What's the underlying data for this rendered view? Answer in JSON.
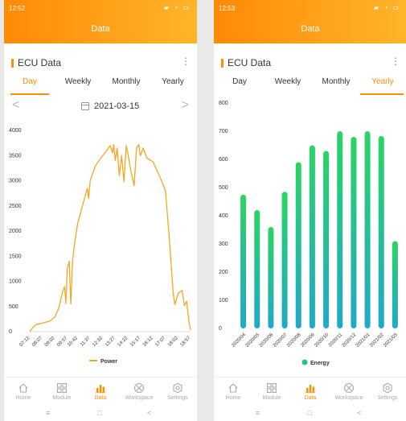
{
  "screens": [
    {
      "status": {
        "time": "12:52",
        "icons": "▰ ◔ ▭"
      },
      "header": {
        "title": "Data"
      },
      "card": {
        "title": "ECU Data",
        "more": "⋮"
      },
      "tabs": [
        {
          "label": "Day",
          "active": true
        },
        {
          "label": "Weekly",
          "active": false
        },
        {
          "label": "Monthly",
          "active": false
        },
        {
          "label": "Yearly",
          "active": false
        }
      ],
      "date": {
        "prev": "<",
        "value": "2021-03-15",
        "next": ">"
      },
      "nav": [
        {
          "label": "Home",
          "icon": "home-icon",
          "active": false
        },
        {
          "label": "Module",
          "icon": "grid-icon",
          "active": false
        },
        {
          "label": "Data",
          "icon": "bar-chart-icon",
          "active": true
        },
        {
          "label": "Workspace",
          "icon": "workspace-icon",
          "active": false
        },
        {
          "label": "Settings",
          "icon": "gear-icon",
          "active": false
        }
      ],
      "sysnav": {
        "menu": "≡",
        "home": "□",
        "back": "<"
      }
    },
    {
      "status": {
        "time": "12:53",
        "icons": "▰ ◔ ▭"
      },
      "header": {
        "title": "Data"
      },
      "card": {
        "title": "ECU Data",
        "more": "⋮"
      },
      "tabs": [
        {
          "label": "Day",
          "active": false
        },
        {
          "label": "Weekly",
          "active": false
        },
        {
          "label": "Monthly",
          "active": false
        },
        {
          "label": "Yearly",
          "active": true
        }
      ],
      "nav": [
        {
          "label": "Home",
          "icon": "home-icon",
          "active": false
        },
        {
          "label": "Module",
          "icon": "grid-icon",
          "active": false
        },
        {
          "label": "Data",
          "icon": "bar-chart-icon",
          "active": true
        },
        {
          "label": "Workspace",
          "icon": "workspace-icon",
          "active": false
        },
        {
          "label": "Settings",
          "icon": "gear-icon",
          "active": false
        }
      ],
      "sysnav": {
        "menu": "≡",
        "home": "□",
        "back": "<"
      }
    }
  ],
  "chart_data": [
    {
      "type": "line",
      "series": [
        {
          "name": "Power",
          "color": "#f5a623"
        }
      ],
      "x": [
        "07:12",
        "08:07",
        "09:02",
        "09:57",
        "10:42",
        "11:37",
        "12:32",
        "13:27",
        "14:22",
        "15:17",
        "16:12",
        "17:07",
        "18:02",
        "18:57"
      ],
      "points": [
        [
          "07:12",
          0
        ],
        [
          "07:25",
          80
        ],
        [
          "07:40",
          140
        ],
        [
          "08:07",
          170
        ],
        [
          "08:40",
          210
        ],
        [
          "09:02",
          290
        ],
        [
          "09:20",
          480
        ],
        [
          "09:35",
          780
        ],
        [
          "09:45",
          900
        ],
        [
          "09:50",
          560
        ],
        [
          "09:57",
          1250
        ],
        [
          "10:05",
          1400
        ],
        [
          "10:12",
          550
        ],
        [
          "10:20",
          1420
        ],
        [
          "10:30",
          1800
        ],
        [
          "10:42",
          2150
        ],
        [
          "11:00",
          2450
        ],
        [
          "11:15",
          2700
        ],
        [
          "11:25",
          2850
        ],
        [
          "11:30",
          2650
        ],
        [
          "11:37",
          3000
        ],
        [
          "12:00",
          3300
        ],
        [
          "12:32",
          3500
        ],
        [
          "12:50",
          3600
        ],
        [
          "13:05",
          3700
        ],
        [
          "13:15",
          3550
        ],
        [
          "13:20",
          3720
        ],
        [
          "13:27",
          3400
        ],
        [
          "13:35",
          3650
        ],
        [
          "13:45",
          3100
        ],
        [
          "13:55",
          3500
        ],
        [
          "14:05",
          2980
        ],
        [
          "14:15",
          3700
        ],
        [
          "14:22",
          3550
        ],
        [
          "14:35",
          3200
        ],
        [
          "14:50",
          2900
        ],
        [
          "15:00",
          3650
        ],
        [
          "15:10",
          3720
        ],
        [
          "15:17",
          3500
        ],
        [
          "15:30",
          3650
        ],
        [
          "15:45",
          3450
        ],
        [
          "16:12",
          3380
        ],
        [
          "16:30",
          3200
        ],
        [
          "16:50",
          3000
        ],
        [
          "17:07",
          2800
        ],
        [
          "17:25",
          1800
        ],
        [
          "17:40",
          800
        ],
        [
          "17:48",
          540
        ],
        [
          "17:55",
          640
        ],
        [
          "18:02",
          760
        ],
        [
          "18:20",
          820
        ],
        [
          "18:30",
          520
        ],
        [
          "18:40",
          600
        ],
        [
          "18:50",
          200
        ],
        [
          "18:57",
          30
        ]
      ],
      "ylim": [
        0,
        4000
      ],
      "yticks": [
        0,
        500,
        1000,
        1500,
        2000,
        2500,
        3000,
        3500,
        4000
      ],
      "legend": "bottom-center",
      "grid": false
    },
    {
      "type": "bar",
      "series": [
        {
          "name": "Energy",
          "color": "#22c87a"
        }
      ],
      "categories": [
        "2020/04",
        "2020/05",
        "2020/06",
        "2020/07",
        "2020/08",
        "2020/09",
        "2020/10",
        "2020/11",
        "2020/12",
        "2021/01",
        "2021/02",
        "2021/03"
      ],
      "values": [
        475,
        420,
        360,
        485,
        590,
        650,
        630,
        700,
        680,
        700,
        683,
        310
      ],
      "ylim": [
        0,
        800
      ],
      "yticks": [
        0,
        100,
        200,
        300,
        400,
        500,
        600,
        700,
        800
      ],
      "legend": "bottom-center",
      "grid": false
    }
  ]
}
